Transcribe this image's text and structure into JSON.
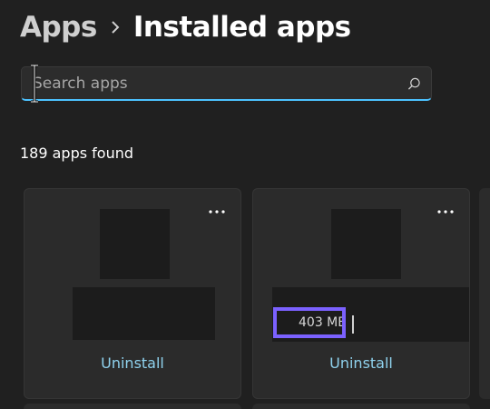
{
  "breadcrumb": {
    "parent": "Apps",
    "current": "Installed apps"
  },
  "search": {
    "placeholder": "Search apps",
    "value": ""
  },
  "results": {
    "count_label": "189 apps found"
  },
  "apps": [
    {
      "name": "",
      "size": "",
      "uninstall_label": "Uninstall"
    },
    {
      "name": "",
      "size": "403 MB",
      "uninstall_label": "Uninstall"
    }
  ],
  "colors": {
    "background": "#202020",
    "card": "#2b2b2b",
    "accent": "#4cc2ff",
    "link": "#8fd2ee",
    "highlight": "#7b61ff",
    "redacted": "#1c1c1c"
  }
}
